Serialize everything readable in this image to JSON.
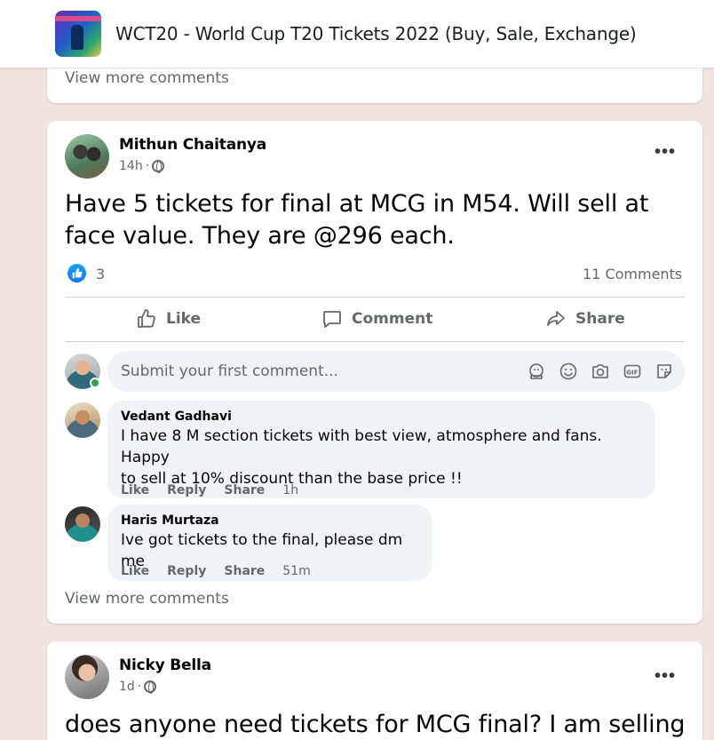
{
  "group": {
    "title": "WCT20 - World Cup T20 Tickets 2022 (Buy, Sale, Exchange)"
  },
  "prev_card": {
    "view_more": "View more comments"
  },
  "post": {
    "author": "Mithun Chaitanya",
    "time": "14h",
    "separator": "·",
    "text_line1": "Have 5 tickets for final at MCG in M54. Will sell at",
    "text_line2": "face value. They are @296 each.",
    "reactions_count": "3",
    "comments_count": "11 Comments",
    "actions": {
      "like": "Like",
      "comment": "Comment",
      "share": "Share"
    },
    "comment_input_placeholder": "Submit your first comment...",
    "comments": [
      {
        "author": "Vedant Gadhavi",
        "text_line1": "I have 8 M section tickets with best view, atmosphere and fans. Happy",
        "text_line2": "to sell at 10% discount than the base price !!",
        "like": "Like",
        "reply": "Reply",
        "share": "Share",
        "time": "1h"
      },
      {
        "author": "Haris Murtaza",
        "text_line1": "Ive got tickets to the final, please dm me",
        "like": "Like",
        "reply": "Reply",
        "share": "Share",
        "time": "51m"
      }
    ],
    "view_more": "View more comments"
  },
  "next_post": {
    "author": "Nicky Bella",
    "time": "1d",
    "separator": "·",
    "text": "does anyone need tickets for MCG final? I am selling"
  },
  "colors": {
    "page_bg": "#f3e4e4",
    "card_bg": "#ffffff",
    "secondary_text": "#65676b",
    "like_blue": "#1877f2",
    "bubble_bg": "#f0f2f5"
  }
}
